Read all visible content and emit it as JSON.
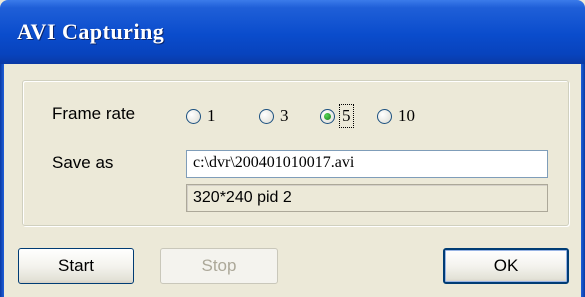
{
  "window": {
    "title": "AVI Capturing"
  },
  "frame_rate": {
    "label": "Frame rate",
    "options": [
      {
        "label": "1",
        "checked": false
      },
      {
        "label": "3",
        "checked": false
      },
      {
        "label": "5",
        "checked": true
      },
      {
        "label": "10",
        "checked": false
      }
    ]
  },
  "save_as": {
    "label": "Save as",
    "value": "c:\\dvr\\200401010017.avi",
    "info": "320*240 pid 2"
  },
  "buttons": {
    "start": "Start",
    "stop": "Stop",
    "ok": "OK"
  },
  "colors": {
    "titlebar": "#0a4ccc",
    "face": "#ece9d8",
    "checked_dot": "#21a121"
  }
}
